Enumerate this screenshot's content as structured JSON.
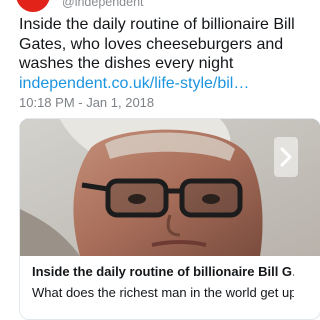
{
  "account": {
    "handle": "@independent",
    "avatar_color": "#e2231a"
  },
  "tweet": {
    "text": "Inside the daily routine of billionaire Bill Gates, who loves cheeseburgers and washes the dishes every night",
    "link_text": "independent.co.uk/life-style/bil…",
    "link_color": "#1b95e0",
    "timestamp": "10:18 PM - Jan 1, 2018"
  },
  "card": {
    "image_alt": "Bill Gates close-up portrait wearing glasses",
    "title": "Inside the daily routine of billionaire Bill G…",
    "description": "What does the richest man in the world get up to",
    "next_icon": "chevron-right-icon"
  }
}
